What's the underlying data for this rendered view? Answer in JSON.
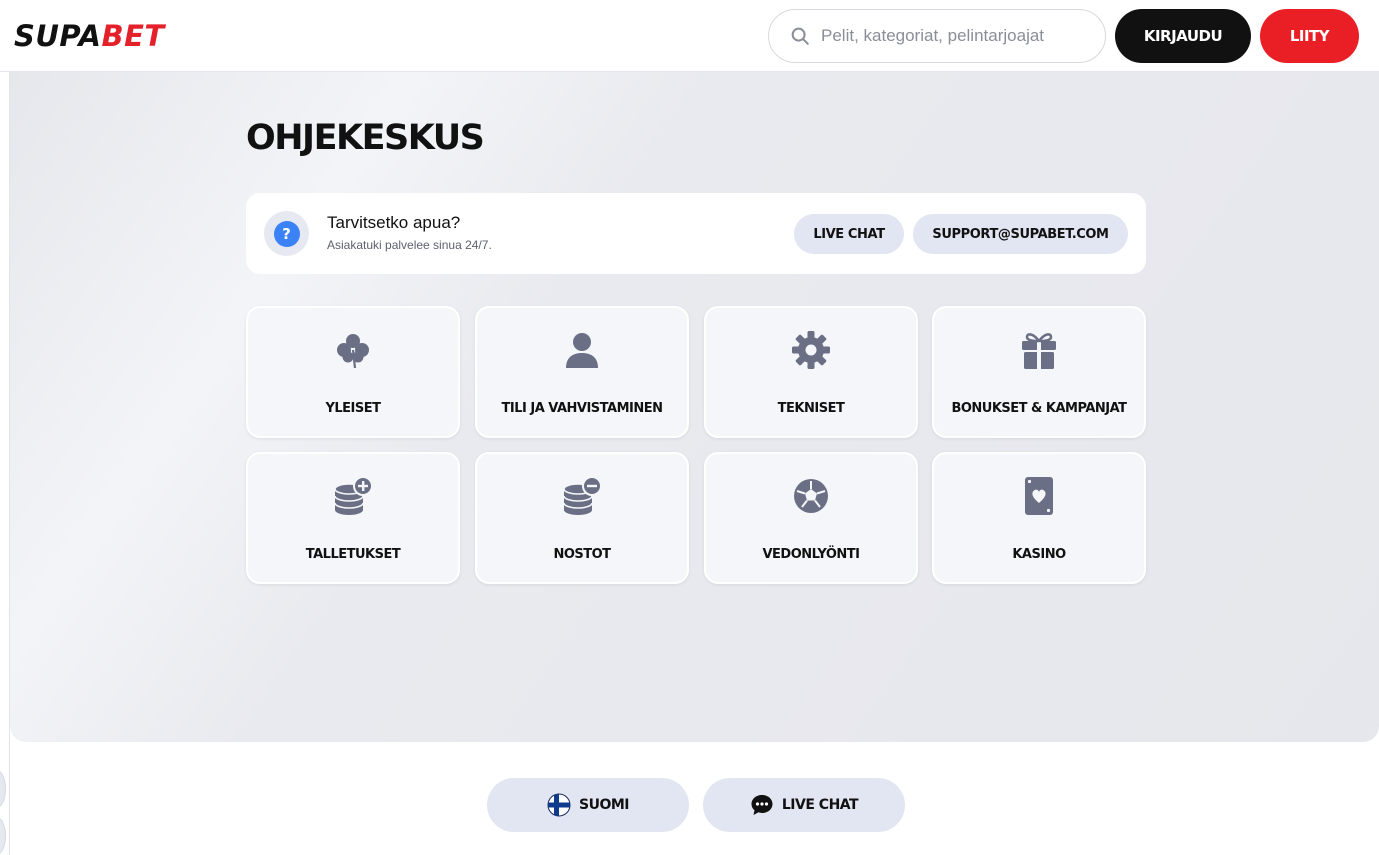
{
  "header": {
    "logo_part1": "SUPA",
    "logo_part2": "BET",
    "search_placeholder": "Pelit, kategoriat, pelintarjoajat",
    "login_label": "KIRJAUDU",
    "join_label": "LIITY"
  },
  "main": {
    "title": "OHJEKESKUS",
    "help": {
      "icon": "question-icon",
      "title": "Tarvitsetko apua?",
      "subtitle": "Asiakatuki palvelee sinua 24/7.",
      "live_chat_label": "LIVE CHAT",
      "email_label": "SUPPORT@SUPABET.COM"
    },
    "categories": [
      {
        "label": "YLEISET",
        "icon": "clover-icon"
      },
      {
        "label": "TILI JA VAHVISTAMINEN",
        "icon": "user-icon"
      },
      {
        "label": "TEKNISET",
        "icon": "gear-icon"
      },
      {
        "label": "BONUKSET & KAMPANJAT",
        "icon": "gift-icon"
      },
      {
        "label": "TALLETUKSET",
        "icon": "coins-plus-icon"
      },
      {
        "label": "NOSTOT",
        "icon": "coins-minus-icon"
      },
      {
        "label": "VEDONLYÖNTI",
        "icon": "football-icon"
      },
      {
        "label": "KASINO",
        "icon": "playing-card-icon"
      }
    ]
  },
  "footer": {
    "language_label": "SUOMI",
    "language_icon": "finland-flag-icon",
    "live_chat_label": "LIVE CHAT",
    "live_chat_icon": "chat-bubble-icon"
  },
  "colors": {
    "brand_red": "#e4202a",
    "icon_gray": "#6b6f85",
    "help_blue": "#3b82f6",
    "pill_bg": "#e2e5f2"
  }
}
